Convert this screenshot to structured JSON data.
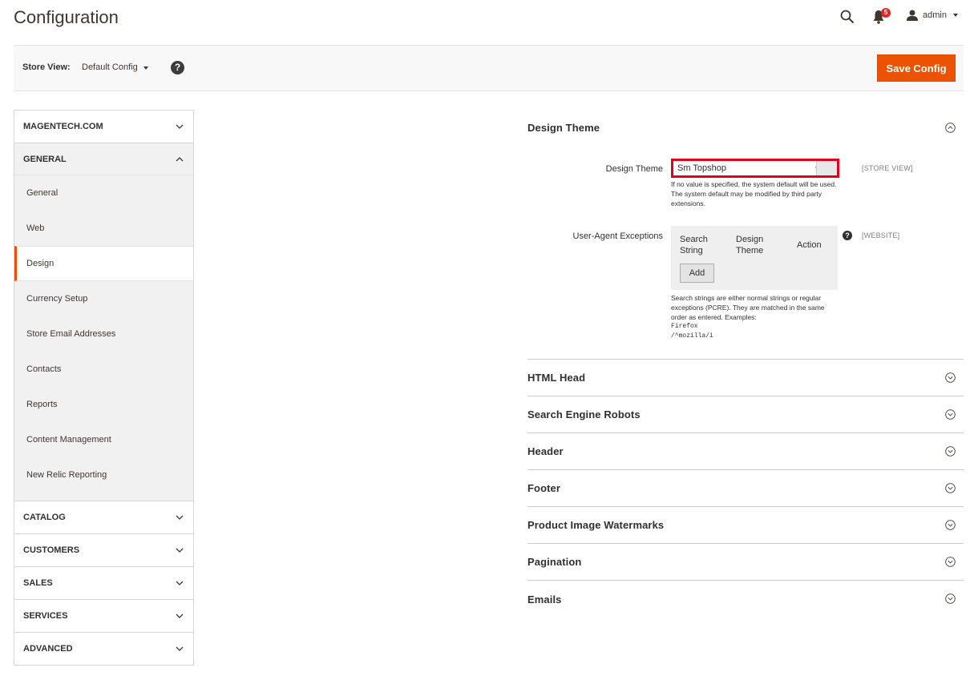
{
  "header": {
    "title": "Configuration",
    "notifications_count": "5",
    "user_name": "admin"
  },
  "store_bar": {
    "label": "Store View:",
    "selected": "Default Config",
    "help_glyph": "?",
    "save_label": "Save Config"
  },
  "sidebar": {
    "sections": [
      {
        "label": "MAGENTECH.COM",
        "open": false
      },
      {
        "label": "GENERAL",
        "open": true
      },
      {
        "label": "CATALOG",
        "open": false
      },
      {
        "label": "CUSTOMERS",
        "open": false
      },
      {
        "label": "SALES",
        "open": false
      },
      {
        "label": "SERVICES",
        "open": false
      },
      {
        "label": "ADVANCED",
        "open": false
      }
    ],
    "general_items": [
      "General",
      "Web",
      "Design",
      "Currency Setup",
      "Store Email Addresses",
      "Contacts",
      "Reports",
      "Content Management",
      "New Relic Reporting"
    ],
    "active_item": "Design"
  },
  "main": {
    "design_theme": {
      "section_title": "Design Theme",
      "field_label": "Design Theme",
      "selected_theme": "Sm Topshop",
      "scope": "[STORE VIEW]",
      "note": "If no value is specified, the system default will be used. The system default may be modified by third party extensions.",
      "ua_label": "User-Agent Exceptions",
      "ua_columns": [
        "Search String",
        "Design Theme",
        "Action"
      ],
      "ua_add": "Add",
      "ua_help": "?",
      "ua_scope": "[WEBSITE]",
      "ua_note": "Search strings are either normal strings or regular exceptions (PCRE). They are matched in the same order as entered. Examples:",
      "ua_example_1": "Firefox",
      "ua_example_2": "/^mozilla/i"
    },
    "sections": [
      "HTML Head",
      "Search Engine Robots",
      "Header",
      "Footer",
      "Product Image Watermarks",
      "Pagination",
      "Emails"
    ]
  }
}
